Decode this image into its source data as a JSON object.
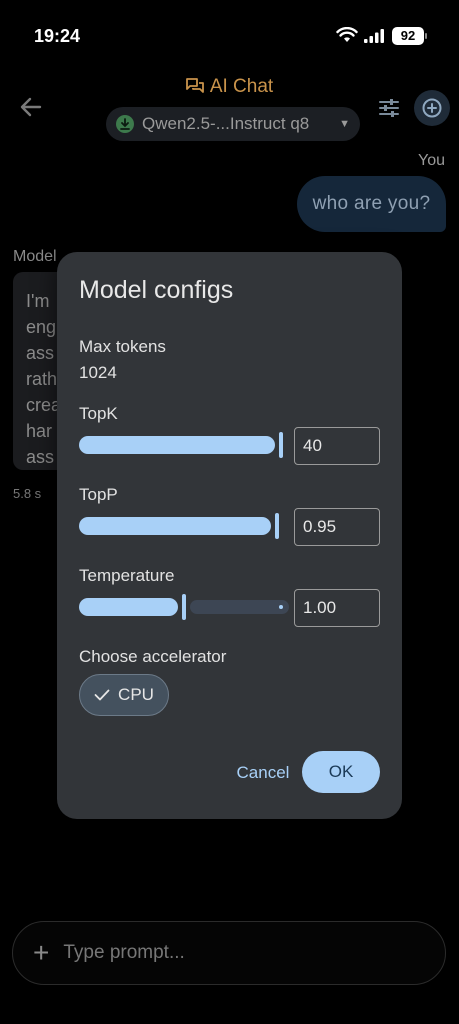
{
  "status_bar": {
    "time": "19:24",
    "battery": "92"
  },
  "header": {
    "title": "AI Chat",
    "model_selector": "Qwen2.5-...Instruct q8"
  },
  "chat": {
    "user_label": "You",
    "user_message": "who are you?",
    "model_label": "Model",
    "model_message_partial": [
      "I'm",
      "eng",
      "ass",
      "rath",
      "crea",
      "har",
      "ass"
    ],
    "latency": "5.8 s"
  },
  "prompt": {
    "placeholder": "Type prompt..."
  },
  "dialog": {
    "title": "Model configs",
    "max_tokens_label": "Max tokens",
    "max_tokens_value": "1024",
    "topk_label": "TopK",
    "topk_value": "40",
    "topk_fraction": 0.97,
    "topp_label": "TopP",
    "topp_value": "0.95",
    "topp_fraction": 0.95,
    "temperature_label": "Temperature",
    "temperature_value": "1.00",
    "temperature_fraction": 0.5,
    "accelerator_label": "Choose accelerator",
    "accelerator_option": "CPU",
    "cancel_label": "Cancel",
    "ok_label": "OK",
    "accent_color": "#a8d0f7"
  }
}
